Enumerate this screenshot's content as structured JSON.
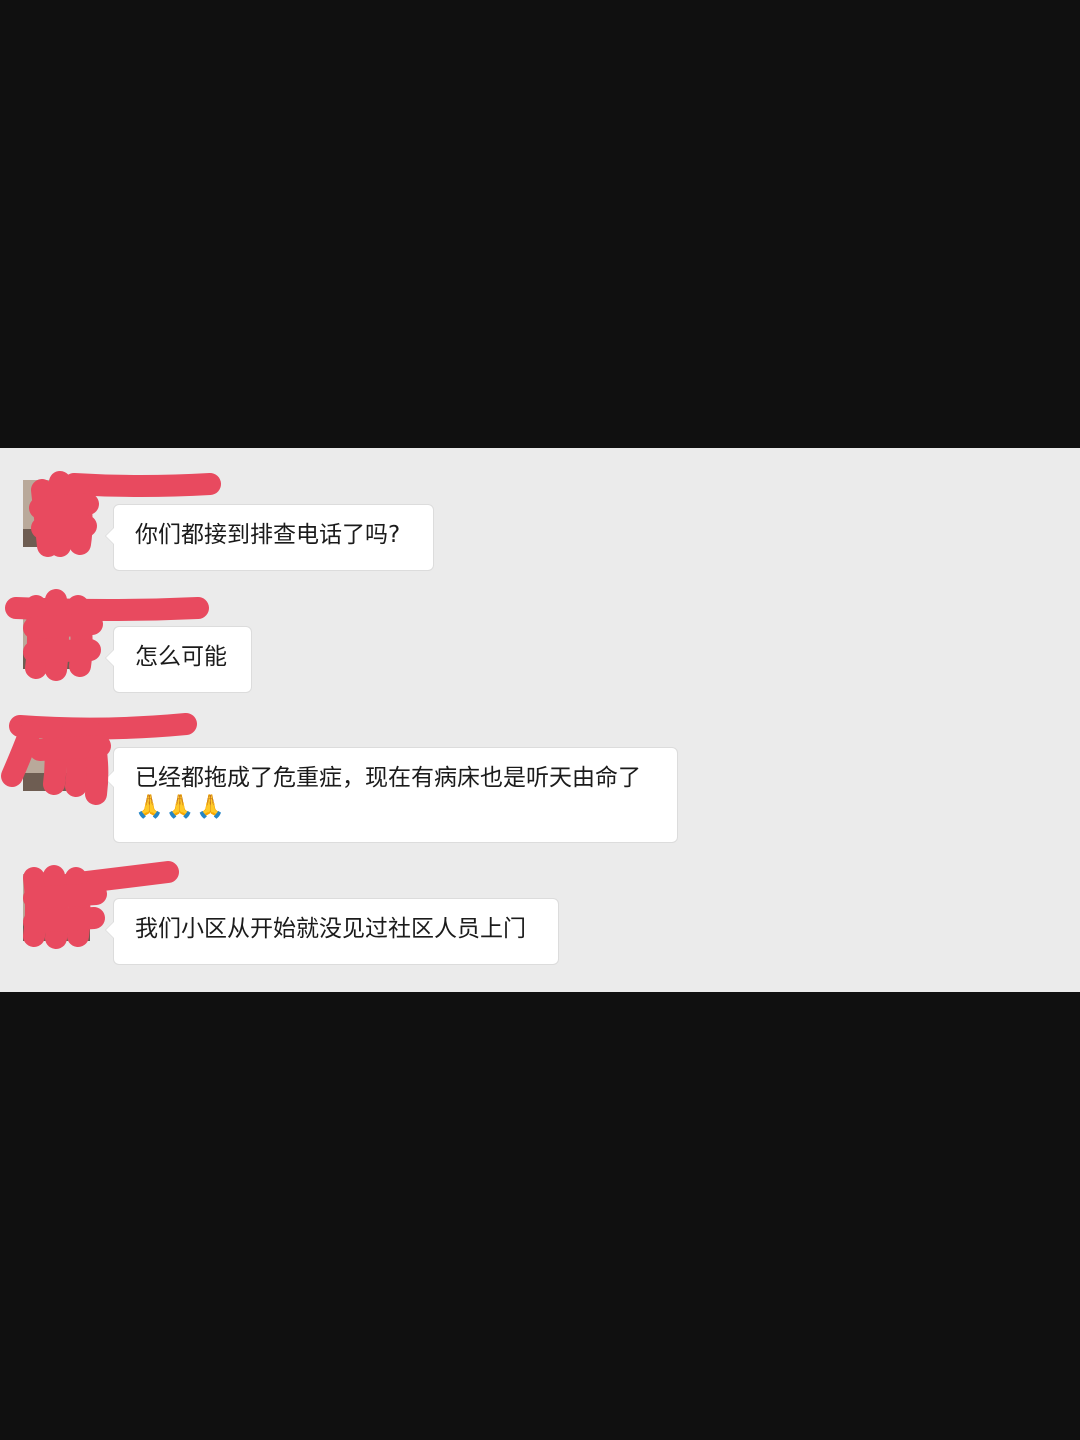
{
  "chat": {
    "messages": [
      {
        "sender": "",
        "text": "你们都接到排查电话了吗?",
        "emoji": ""
      },
      {
        "sender": "",
        "text": "怎么可能",
        "emoji": ""
      },
      {
        "sender": "",
        "text": "已经都拖成了危重症，现在有病床也是听天由命了",
        "emoji": "🙏🙏🙏"
      },
      {
        "sender": "",
        "text": "我们小区从开始就没见过社区人员上门",
        "emoji": ""
      }
    ]
  },
  "colors": {
    "background": "#101010",
    "chat_background": "#ebebeb",
    "bubble": "#ffffff",
    "redaction": "#e84a5f"
  },
  "icons": {
    "emoji": "folded-hands-icon"
  }
}
